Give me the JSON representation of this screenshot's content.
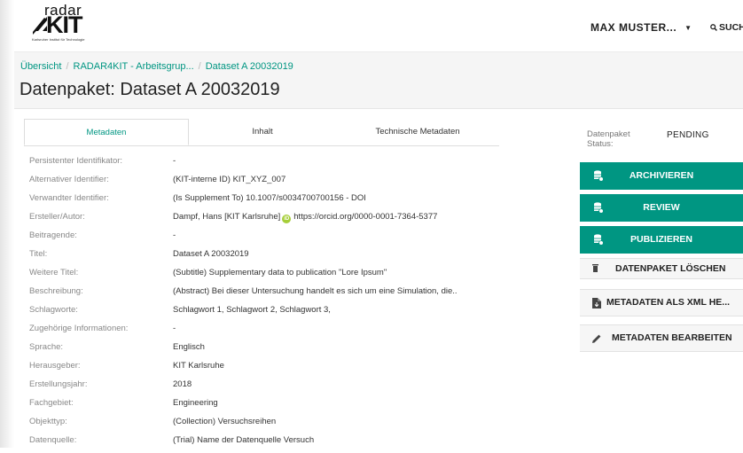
{
  "header": {
    "logo_top": "radar",
    "logo_main": "KIT",
    "logo_tagline": "Karlsruher Institut für Technologie",
    "user_name": "MAX MUSTER...",
    "search_label": "SUCHE"
  },
  "breadcrumb": [
    "Übersicht",
    "RADAR4KIT - Arbeitsgrup...",
    "Dataset A 20032019"
  ],
  "page_title": "Datenpaket: Dataset A 20032019",
  "tabs": [
    "Metadaten",
    "Inhalt",
    "Technische Metadaten"
  ],
  "metadata": [
    {
      "label": "Persistenter Identifikator:",
      "value": "-"
    },
    {
      "label": "Alternativer Identifier:",
      "value": "(KIT-interne ID) KIT_XYZ_007"
    },
    {
      "label": "Verwandter Identifier:",
      "value": "(Is Supplement To) 10.1007/s0034700700156 - DOI"
    },
    {
      "label": "Ersteller/Autor:",
      "value": "Dampf, Hans [KIT Karlsruhe]",
      "orcid_url": "https://orcid.org/0000-0001-7364-5377"
    },
    {
      "label": "Beitragende:",
      "value": "-"
    },
    {
      "label": "Titel:",
      "value": "Dataset A 20032019"
    },
    {
      "label": "Weitere Titel:",
      "value": "(Subtitle) Supplementary data to publication \"Lore Ipsum\""
    },
    {
      "label": "Beschreibung:",
      "value": "(Abstract) Bei dieser Untersuchung handelt es sich um eine Simulation, die.."
    },
    {
      "label": "Schlagworte:",
      "value": "Schlagwort 1, Schlagwort 2, Schlagwort 3,"
    },
    {
      "label": "Zugehörige Informationen:",
      "value": "-"
    },
    {
      "label": "Sprache:",
      "value": "Englisch"
    },
    {
      "label": "Herausgeber:",
      "value": "KIT Karlsruhe"
    },
    {
      "label": "Erstellungsjahr:",
      "value": "2018"
    },
    {
      "label": "Fachgebiet:",
      "value": "Engineering"
    },
    {
      "label": "Objekttyp:",
      "value": "(Collection) Versuchsreihen"
    },
    {
      "label": "Datenquelle:",
      "value": "(Trial) Name der Datenquelle Versuch"
    }
  ],
  "sidebar": {
    "status_label": "Datenpaket Status:",
    "status_value": "PENDING",
    "buttons": [
      {
        "label": "ARCHIVIEREN",
        "icon": "database-icon",
        "style": "primary"
      },
      {
        "label": "REVIEW",
        "icon": "database-icon",
        "style": "primary"
      },
      {
        "label": "PUBLIZIEREN",
        "icon": "database-icon",
        "style": "primary"
      },
      {
        "label": "DATENPAKET LÖSCHEN",
        "icon": "trash-icon",
        "style": "plain"
      },
      {
        "label": "METADATEN ALS XML HE...",
        "icon": "file-download-icon",
        "style": "plain"
      },
      {
        "label": "METADATEN BEARBEITEN",
        "icon": "pencil-icon",
        "style": "plain"
      }
    ]
  },
  "colors": {
    "accent": "#009682",
    "label_gray": "#888888",
    "orcid_green": "#a6ce39"
  }
}
